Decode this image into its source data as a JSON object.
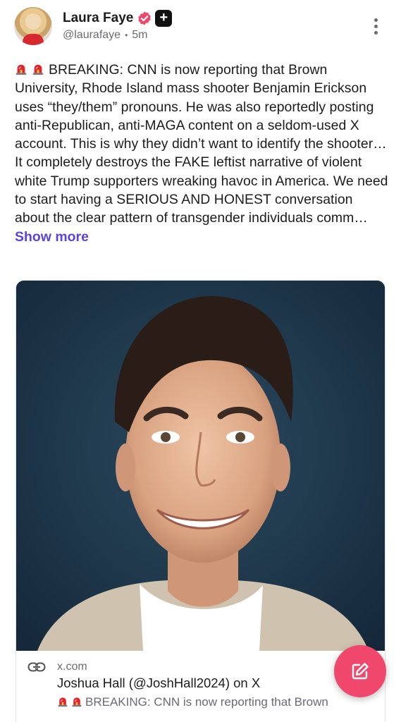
{
  "post": {
    "author": {
      "display_name": "Laura Faye",
      "handle": "@laurafaye",
      "time": "5m",
      "avatar_icon": "profile-photo",
      "verified_icon": "verified-badge-icon",
      "badge_icon": "plus-badge-icon",
      "badge_glyph": "+"
    },
    "separator": "•",
    "text_main": "BREAKING: CNN is now reporting that Brown University, Rhode Island mass shooter Benjamin Erickson uses “they/them” pronouns. He was also reportedly posting anti-Republican, anti-MAGA content on a seldom-used X account. This is why they didn’t want to identify the shooter… It completely destroys the FAKE leftist narrative of violent white Trump supporters wreaking havoc in America. We need to start having a SERIOUS AND HONEST conversation about the clear pattern of transgender individuals comm…",
    "show_more_label": "Show more",
    "link_card": {
      "domain": "x.com",
      "title": "Joshua Hall (@JoshHall2024) on X",
      "description": "BREAKING: CNN is now reporting that Brown",
      "image_icon": "portrait-photo"
    },
    "more_icon": "kebab-menu-icon",
    "compose_icon": "compose-icon"
  },
  "colors": {
    "accent_link": "#5b45d6",
    "verified": "#f0476d",
    "fab": "#f0476d",
    "photo_background": "#1f3a4d"
  }
}
